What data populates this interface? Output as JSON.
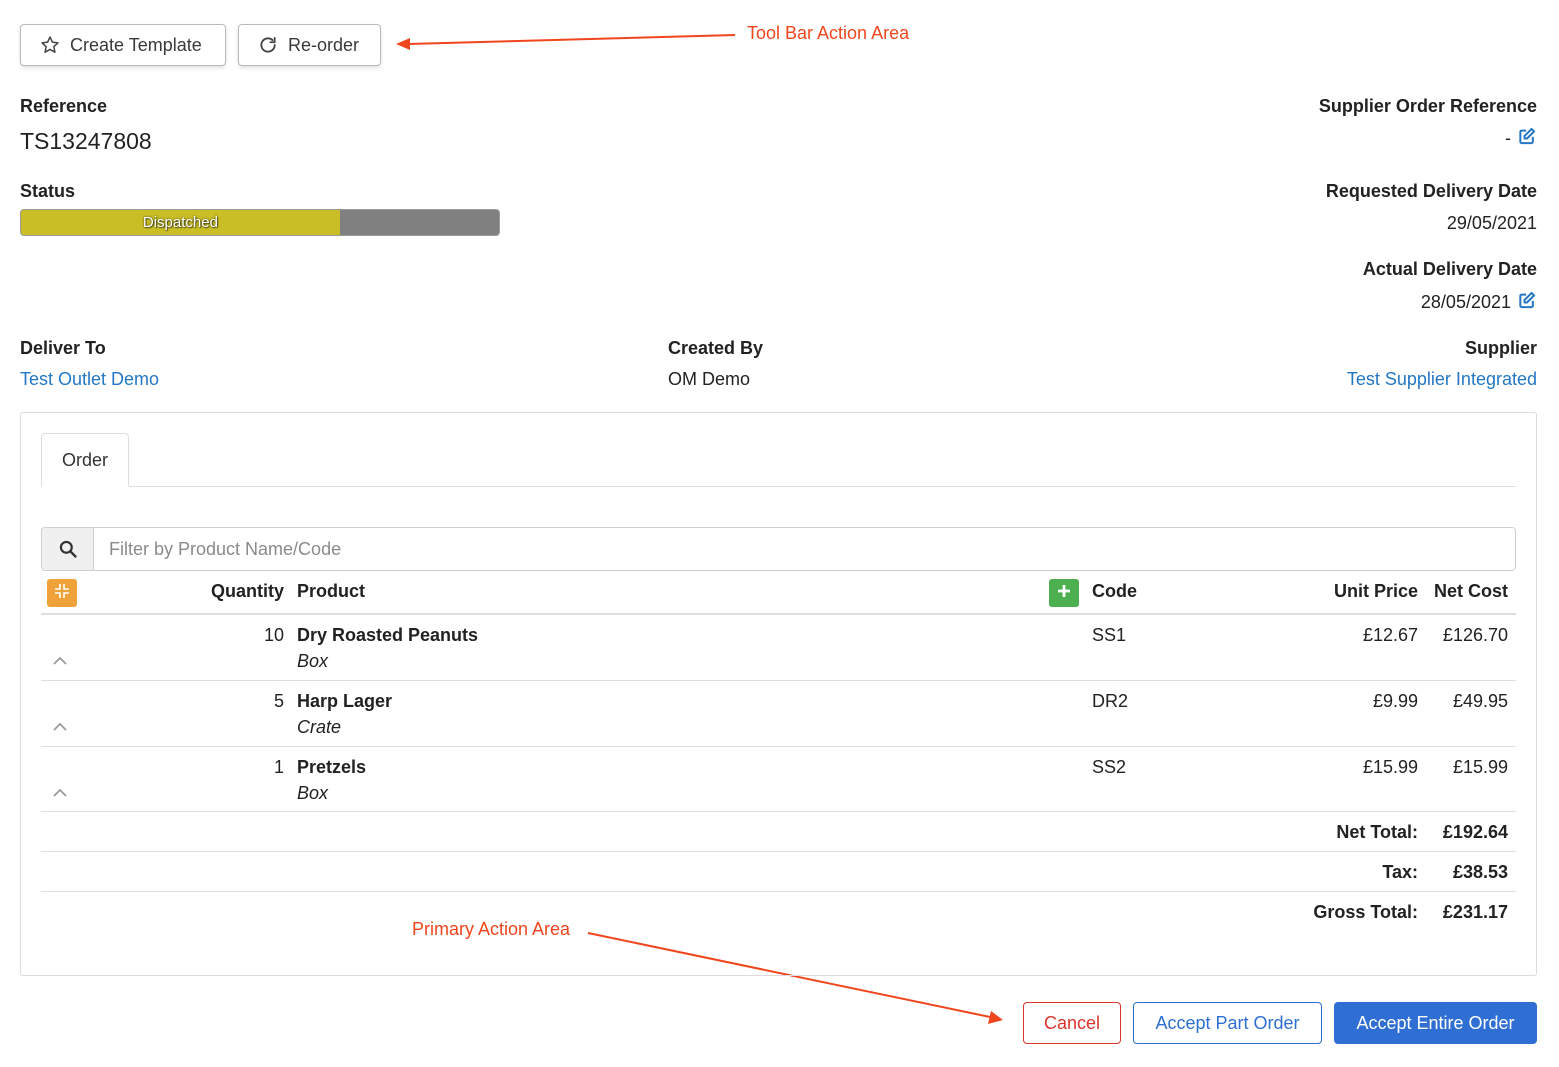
{
  "toolbar": {
    "create_template_label": "Create Template",
    "reorder_label": "Re-order"
  },
  "annotations": {
    "toolbar_area": "Tool Bar Action Area",
    "primary_area": "Primary Action Area",
    "arrow_color": "#f0461e"
  },
  "header": {
    "reference_label": "Reference",
    "reference_value": "TS13247808",
    "supplier_ref_label": "Supplier Order Reference",
    "supplier_ref_value": "-",
    "status_label": "Status",
    "status_value": "Dispatched",
    "status_progress": 0.667,
    "requested_date_label": "Requested Delivery Date",
    "requested_date_value": "29/05/2021",
    "actual_date_label": "Actual Delivery Date",
    "actual_date_value": "28/05/2021",
    "deliver_to_label": "Deliver To",
    "deliver_to_value": "Test Outlet Demo",
    "created_by_label": "Created By",
    "created_by_value": "OM Demo",
    "supplier_label": "Supplier",
    "supplier_value": "Test Supplier Integrated"
  },
  "tabs": [
    {
      "label": "Order"
    }
  ],
  "search": {
    "placeholder": "Filter by Product Name/Code"
  },
  "table": {
    "columns": {
      "quantity": "Quantity",
      "product": "Product",
      "code": "Code",
      "unit_price": "Unit Price",
      "net_cost": "Net Cost"
    },
    "rows": [
      {
        "quantity": "10",
        "product": "Dry Roasted Peanuts",
        "unit": "Box",
        "code": "SS1",
        "unit_price": "£12.67",
        "net_cost": "£126.70"
      },
      {
        "quantity": "5",
        "product": "Harp Lager",
        "unit": "Crate",
        "code": "DR2",
        "unit_price": "£9.99",
        "net_cost": "£49.95"
      },
      {
        "quantity": "1",
        "product": "Pretzels",
        "unit": "Box",
        "code": "SS2",
        "unit_price": "£15.99",
        "net_cost": "£15.99"
      }
    ],
    "totals": [
      {
        "label": "Net Total:",
        "value": "£192.64"
      },
      {
        "label": "Tax:",
        "value": "£38.53"
      },
      {
        "label": "Gross Total:",
        "value": "£231.17"
      }
    ]
  },
  "actions": {
    "cancel_label": "Cancel",
    "accept_part_label": "Accept Part Order",
    "accept_entire_label": "Accept Entire Order"
  },
  "colors": {
    "link": "#2477c4",
    "status_fill": "#c9be26",
    "status_track": "#808080",
    "collapse_button": "#f0a23a",
    "add_button": "#4caf50",
    "cancel": "#d9342b",
    "primary": "#2f6fd4"
  }
}
